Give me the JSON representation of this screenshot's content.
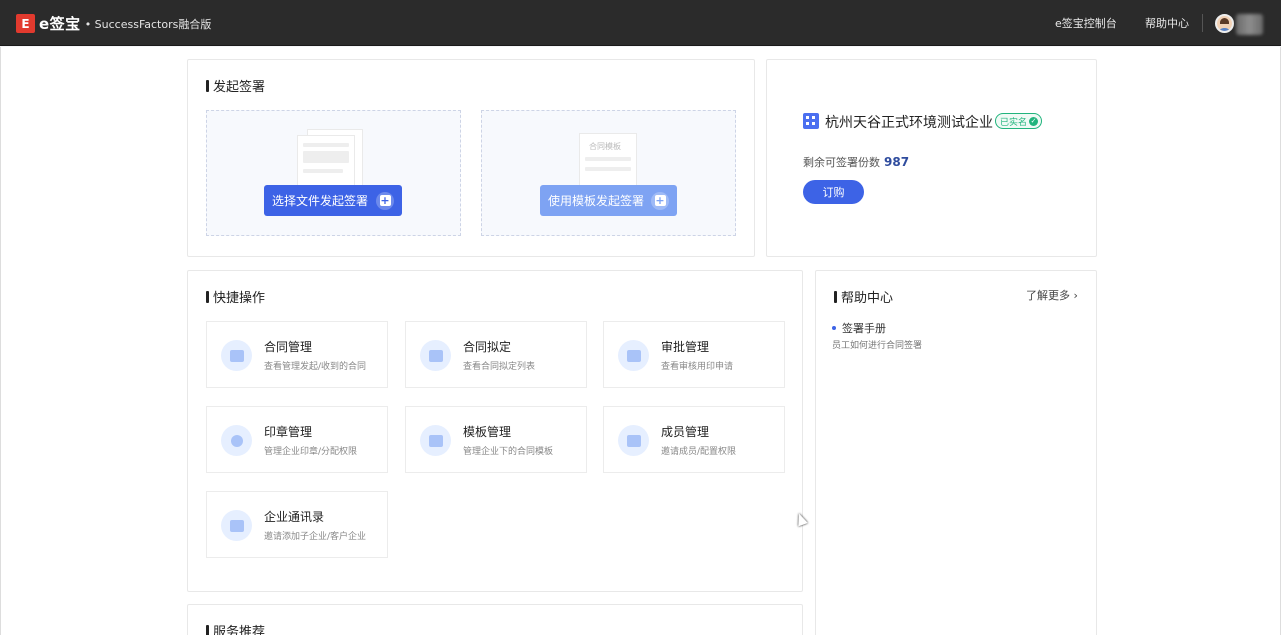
{
  "topbar": {
    "logo_mark": "E",
    "logo_name": "e签宝",
    "logo_sub": "• SuccessFactors融合版",
    "console_link": "e签宝控制台",
    "help_link": "帮助中心"
  },
  "launch": {
    "title": "发起签署",
    "file_button": "选择文件发起签署",
    "template_button": "使用模板发起签署",
    "template_illu_text": "合同模板"
  },
  "company": {
    "name": "杭州天谷正式环境测试企业",
    "verified_badge": "已实名",
    "remaining_label": "剩余可签署份数",
    "remaining_count": "987",
    "order_button": "订购"
  },
  "quick": {
    "title": "快捷操作",
    "items": [
      {
        "title": "合同管理",
        "desc": "查看管理发起/收到的合同"
      },
      {
        "title": "合同拟定",
        "desc": "查看合同拟定列表"
      },
      {
        "title": "审批管理",
        "desc": "查看审核用印申请"
      },
      {
        "title": "印章管理",
        "desc": "管理企业印章/分配权限"
      },
      {
        "title": "模板管理",
        "desc": "管理企业下的合同模板"
      },
      {
        "title": "成员管理",
        "desc": "邀请成员/配置权限"
      },
      {
        "title": "企业通讯录",
        "desc": "邀请添加子企业/客户企业"
      }
    ]
  },
  "help": {
    "title": "帮助中心",
    "learn_more": "了解更多 ›",
    "items": [
      {
        "title": "签署手册",
        "desc": "员工如何进行合同签署"
      }
    ]
  },
  "service": {
    "title": "服务推荐"
  },
  "colors": {
    "topbar": "#2b2b2b",
    "primary": "#3d63e6",
    "brand_red": "#e23a2e",
    "verified_green": "#21b47d"
  }
}
